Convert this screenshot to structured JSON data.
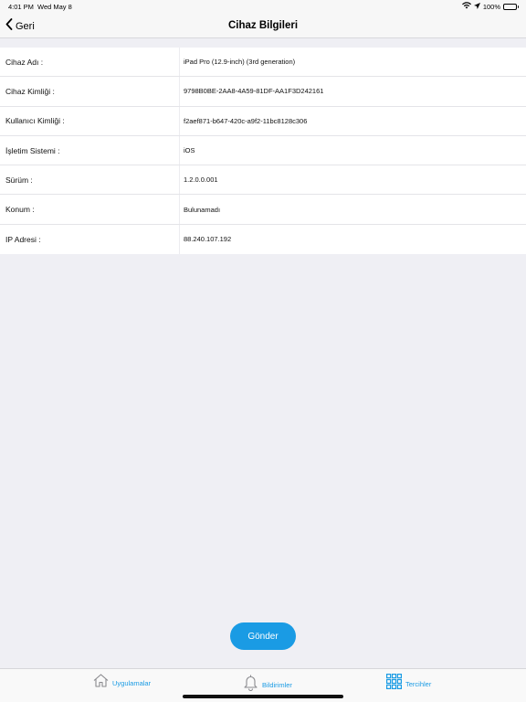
{
  "status_bar": {
    "time": "4:01 PM",
    "date": "Wed May 8",
    "battery": "100%",
    "icons": [
      "wifi-icon",
      "location-arrow-icon",
      "battery-icon"
    ]
  },
  "nav": {
    "back_label": "Geri",
    "title": "Cihaz Bilgileri"
  },
  "info": {
    "rows": [
      {
        "label": "Cihaz Adı :",
        "value": "iPad Pro (12.9-inch) (3rd generation)"
      },
      {
        "label": "Cihaz Kimliği :",
        "value": "9798B0BE-2AA8-4A59-81DF-AA1F3D242161"
      },
      {
        "label": "Kullanıcı Kimliği :",
        "value": "f2aef871-b647-420c-a9f2-11bc8128c306"
      },
      {
        "label": "İşletim Sistemi :",
        "value": "iOS"
      },
      {
        "label": "Sürüm :",
        "value": "1.2.0.0.001"
      },
      {
        "label": "Konum :",
        "value": "Bulunamadı"
      },
      {
        "label": "IP Adresi :",
        "value": "88.240.107.192"
      }
    ]
  },
  "actions": {
    "send_label": "Gönder"
  },
  "tabs": [
    {
      "label": "Uygulamalar",
      "icon": "home-icon"
    },
    {
      "label": "Bildirimler",
      "icon": "bell-icon"
    },
    {
      "label": "Tercihler",
      "icon": "grid-icon"
    }
  ],
  "colors": {
    "accent": "#1a9be4",
    "background": "#efeff4"
  }
}
